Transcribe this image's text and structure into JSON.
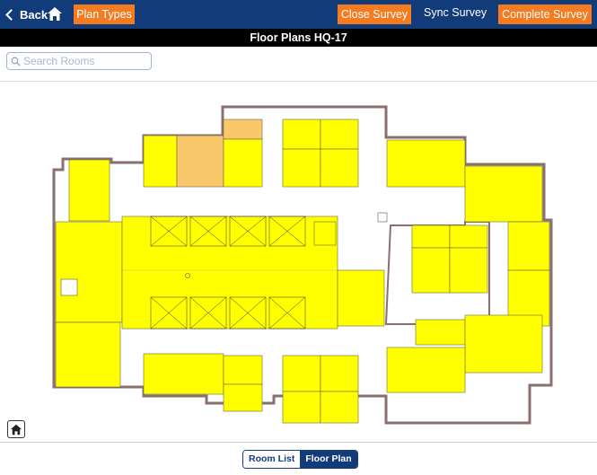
{
  "header": {
    "back_label": "Back",
    "plan_types_label": "Plan Types",
    "close_survey_label": "Close Survey",
    "sync_survey_label": "Sync Survey",
    "complete_survey_label": "Complete Survey"
  },
  "title": "Floor Plans HQ-17",
  "search": {
    "placeholder": "Search Rooms"
  },
  "view_tabs": {
    "room_list": "Room List",
    "floor_plan": "Floor Plan"
  },
  "colors": {
    "header": "#123b7a",
    "accent": "#f47b20",
    "room_fill": "#ffff00",
    "room_selected": "#f9c86a"
  },
  "icons": [
    "chevron-left-icon",
    "home-icon",
    "search-icon"
  ]
}
